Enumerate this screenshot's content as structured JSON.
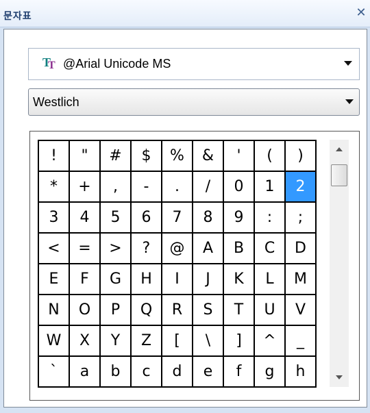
{
  "window": {
    "title": "문자표",
    "close_symbol": "✕"
  },
  "font_selector": {
    "icon": "truetype-font-icon",
    "icon_text_1": "T",
    "icon_text_2": "T",
    "value": "@Arial Unicode MS"
  },
  "subset_selector": {
    "value": "Westlich"
  },
  "char_grid": {
    "selected": "2",
    "rows": [
      [
        "!",
        "\"",
        "#",
        "$",
        "%",
        "&",
        "'",
        "(",
        ")"
      ],
      [
        "*",
        "+",
        ",",
        "-",
        ".",
        "/",
        "0",
        "1",
        "2"
      ],
      [
        "3",
        "4",
        "5",
        "6",
        "7",
        "8",
        "9",
        ":",
        ";"
      ],
      [
        "<",
        "=",
        ">",
        "?",
        "@",
        "A",
        "B",
        "C",
        "D"
      ],
      [
        "E",
        "F",
        "G",
        "H",
        "I",
        "J",
        "K",
        "L",
        "M"
      ],
      [
        "N",
        "O",
        "P",
        "Q",
        "R",
        "S",
        "T",
        "U",
        "V"
      ],
      [
        "W",
        "X",
        "Y",
        "Z",
        "[",
        "\\",
        "]",
        "^",
        "_"
      ],
      [
        "`",
        "a",
        "b",
        "c",
        "d",
        "e",
        "f",
        "g",
        "h"
      ]
    ]
  },
  "scrollbar": {
    "position": 0.05
  }
}
